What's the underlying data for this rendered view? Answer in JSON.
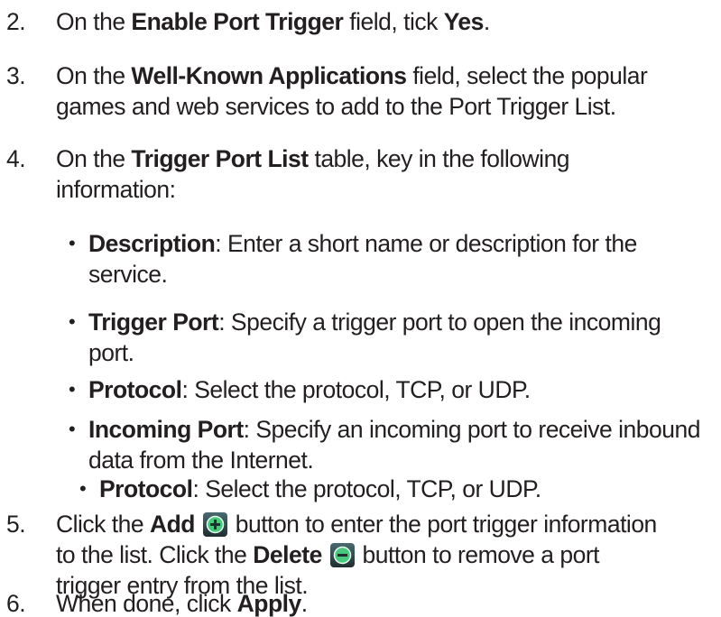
{
  "steps": [
    {
      "number": "2.",
      "lines": [
        {
          "parts": [
            [
              "t",
              "On the "
            ],
            [
              "b",
              "Enable Port Trigger"
            ],
            [
              "t",
              " field, tick "
            ],
            [
              "b",
              "Yes"
            ],
            [
              "t",
              "."
            ]
          ]
        }
      ]
    },
    {
      "number": "3.",
      "lines": [
        {
          "parts": [
            [
              "t",
              "On the "
            ],
            [
              "b",
              "Well-Known Applications"
            ],
            [
              "t",
              " field, select the popular"
            ]
          ]
        },
        {
          "parts": [
            [
              "t",
              "games and web services to add to the Port Trigger List."
            ]
          ]
        }
      ]
    },
    {
      "number": "4.",
      "lines": [
        {
          "parts": [
            [
              "t",
              "On the "
            ],
            [
              "b",
              "Trigger Port List"
            ],
            [
              "t",
              " table, key in the following"
            ]
          ]
        },
        {
          "parts": [
            [
              "t",
              "information:"
            ]
          ]
        }
      ]
    },
    {
      "number": "5.",
      "lines": [
        {
          "parts": [
            [
              "t",
              "Click the "
            ],
            [
              "b",
              "Add"
            ],
            [
              "t",
              " "
            ],
            [
              "icon",
              "add-icon"
            ],
            [
              "t",
              " button to enter the port trigger information"
            ]
          ]
        },
        {
          "parts": [
            [
              "t",
              "to the list. Click the "
            ],
            [
              "b",
              "Delete"
            ],
            [
              "t",
              " "
            ],
            [
              "icon",
              "delete-icon"
            ],
            [
              "t",
              " button to remove a port"
            ]
          ]
        },
        {
          "parts": [
            [
              "t",
              "trigger entry from the list."
            ]
          ]
        }
      ]
    },
    {
      "number": "6.",
      "lines": [
        {
          "parts": [
            [
              "t",
              "When done, click "
            ],
            [
              "b",
              "Apply"
            ],
            [
              "t",
              "."
            ]
          ]
        }
      ]
    }
  ],
  "bullets": [
    {
      "bullet": "•",
      "lines": [
        {
          "parts": [
            [
              "b",
              "Description"
            ],
            [
              "t",
              ": Enter a short name or description for the"
            ]
          ]
        },
        {
          "parts": [
            [
              "t",
              "service."
            ]
          ]
        }
      ]
    },
    {
      "bullet": "•",
      "lines": [
        {
          "parts": [
            [
              "b",
              "Trigger Port"
            ],
            [
              "t",
              ": Specify a trigger port to open the incoming"
            ]
          ]
        },
        {
          "parts": [
            [
              "t",
              "port."
            ]
          ]
        }
      ]
    },
    {
      "bullet": "•",
      "lines": [
        {
          "parts": [
            [
              "b",
              "Protocol"
            ],
            [
              "t",
              ": Select the protocol, TCP, or UDP."
            ]
          ]
        }
      ]
    },
    {
      "bullet": "•",
      "lines": [
        {
          "parts": [
            [
              "b",
              "Incoming Port"
            ],
            [
              "t",
              ": Specify an incoming port to receive inbound"
            ]
          ]
        },
        {
          "parts": [
            [
              "t",
              "data from the Internet."
            ]
          ]
        }
      ]
    },
    {
      "bullet": "•",
      "sub": true,
      "lines": [
        {
          "parts": [
            [
              "b",
              "Protocol"
            ],
            [
              "t",
              ": Select the protocol, TCP, or UDP."
            ]
          ]
        }
      ]
    }
  ],
  "colors": {
    "text": "#231f20",
    "icon_bg": "#2f4448",
    "icon_circle": "#46c97a"
  }
}
